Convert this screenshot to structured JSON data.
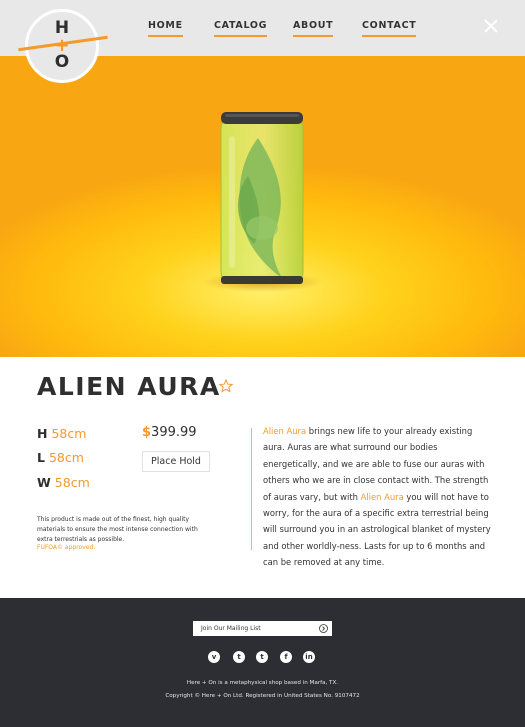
{
  "brand": {
    "letter_top": "H",
    "letter_mid": "+",
    "letter_bottom": "O"
  },
  "nav": {
    "items": [
      "HOME",
      "CATALOG",
      "ABOUT",
      "CONTACT"
    ],
    "close_icon": "close-icon"
  },
  "colors": {
    "accent": "#f39a2a",
    "header_bg": "#e8e8e8",
    "footer_bg": "#2c2e33",
    "hero_bg": "#ffc21a",
    "text": "#2f2f2f"
  },
  "product": {
    "title": "ALIEN AURA",
    "favorite_icon": "star-icon",
    "dimensions": [
      {
        "key": "H",
        "value": "58cm"
      },
      {
        "key": "L",
        "value": "58cm"
      },
      {
        "key": "W",
        "value": "58cm"
      }
    ],
    "price_symbol": "$",
    "price_value": "399.99",
    "hold_label": "Place Hold",
    "note": "This product is made out of the finest, high quality materials to ensure the most intense connection with extra terrestrials as possible.",
    "note_accent": "FUFOA© approved.",
    "description": {
      "name1": "Alien Aura",
      "part1": " brings new life to your already existing aura. Auras are what surround our bodies energetically, and we are able to fuse our auras with others who we are in close contact with. The strength of auras vary, but with ",
      "name2": "Alien Aura",
      "part2": " you will not have to worry, for the aura of a specific extra terrestrial being will surround you in an astrological blanket of mystery and other worldly-ness. Lasts for up to 6 months and can be removed at any time."
    }
  },
  "footer": {
    "mailing_label": "Join Our Mailing List",
    "socials": [
      {
        "icon": "vimeo-icon",
        "glyph": "v"
      },
      {
        "icon": "twitter-icon",
        "glyph": "t"
      },
      {
        "icon": "tumblr-icon",
        "glyph": "t"
      },
      {
        "icon": "facebook-icon",
        "glyph": "f"
      },
      {
        "icon": "linkedin-icon",
        "glyph": "in"
      }
    ],
    "tagline": "Here + On is a metaphysical shop based in Marfa, TX.",
    "copyright": "Copyright © Here + On Ltd. Registered in United States No. 9107472"
  }
}
